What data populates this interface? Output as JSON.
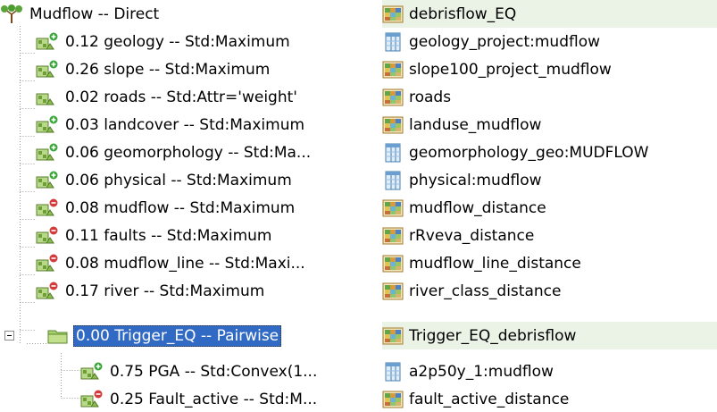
{
  "tree": {
    "root": {
      "label": "Mudflow -- Direct",
      "dataset": "debrisflow_EQ",
      "icon": "tree-icon",
      "dataset_icon": "raster-icon"
    },
    "items": [
      {
        "label": "0.12 geology -- Std:Maximum",
        "sign": "plus",
        "dataset": "geology_project:mudflow",
        "dataset_icon": "table-icon"
      },
      {
        "label": "0.26 slope -- Std:Maximum",
        "sign": "plus",
        "dataset": "slope100_project_mudflow",
        "dataset_icon": "raster-icon"
      },
      {
        "label": "0.02 roads -- Std:Attr='weight'",
        "sign": "none",
        "dataset": "roads",
        "dataset_icon": "raster-icon"
      },
      {
        "label": "0.03 landcover -- Std:Maximum",
        "sign": "plus",
        "dataset": "landuse_mudflow",
        "dataset_icon": "raster-icon"
      },
      {
        "label": "0.06 geomorphology -- Std:Ma...",
        "sign": "plus",
        "dataset": "geomorphology_geo:MUDFLOW",
        "dataset_icon": "table-icon"
      },
      {
        "label": "0.06 physical -- Std:Maximum",
        "sign": "plus",
        "dataset": "physical:mudflow",
        "dataset_icon": "table-icon"
      },
      {
        "label": "0.08 mudflow -- Std:Maximum",
        "sign": "minus",
        "dataset": "mudflow_distance",
        "dataset_icon": "raster-icon"
      },
      {
        "label": "0.11 faults -- Std:Maximum",
        "sign": "minus",
        "dataset": "rRveva_distance",
        "dataset_icon": "raster-icon"
      },
      {
        "label": "0.08 mudflow_line -- Std:Maxi...",
        "sign": "minus",
        "dataset": "mudflow_line_distance",
        "dataset_icon": "raster-icon"
      },
      {
        "label": "0.17 river -- Std:Maximum",
        "sign": "minus",
        "dataset": "river_class_distance",
        "dataset_icon": "raster-icon"
      }
    ],
    "group": {
      "label": "0.00 Trigger_EQ -- Pairwise",
      "dataset": "Trigger_EQ_debrisflow",
      "icon": "folder-icon",
      "dataset_icon": "raster-icon",
      "expanded": true,
      "selected": true,
      "children": [
        {
          "label": "0.75 PGA -- Std:Convex(1...",
          "sign": "plus",
          "dataset": "a2p50y_1:mudflow",
          "dataset_icon": "table-icon"
        },
        {
          "label": "0.25 Fault_active -- Std:M...",
          "sign": "minus",
          "dataset": "fault_active_distance",
          "dataset_icon": "raster-icon"
        }
      ]
    },
    "colors": {
      "selection": "#316ac5",
      "highlight_bg": "#eaf3e6",
      "plus": "#3aa63a",
      "minus": "#d23b3b",
      "node": "#8dbb4e"
    }
  }
}
